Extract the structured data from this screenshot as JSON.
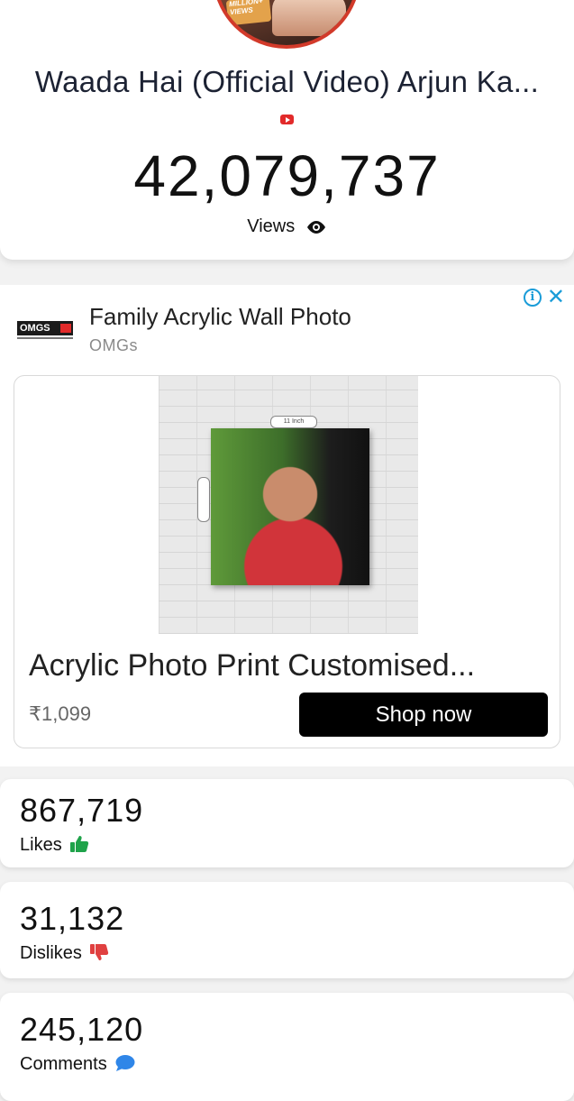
{
  "video": {
    "title": "Waada Hai (Official Video) Arjun Ka...",
    "thumbnail_badge": "MILLION+ VIEWS",
    "views": "42,079,737",
    "views_label": "Views"
  },
  "ad": {
    "headline": "Family Acrylic Wall Photo",
    "advertiser": "OMGs",
    "logo_text": "OMGS",
    "measure_label": "11 Inch",
    "product_title": "Acrylic Photo Print Customised...",
    "price": "₹1,099",
    "cta": "Shop now"
  },
  "stats": {
    "likes": {
      "value": "867,719",
      "label": "Likes"
    },
    "dislikes": {
      "value": "31,132",
      "label": "Dislikes"
    },
    "comments": {
      "value": "245,120",
      "label": "Comments"
    }
  },
  "colors": {
    "youtube_red": "#e22a2a",
    "likes_green": "#1fa34a",
    "dislikes_red": "#e04040",
    "comments_blue": "#2f86e8",
    "adchoices_blue": "#1a9cd8"
  }
}
